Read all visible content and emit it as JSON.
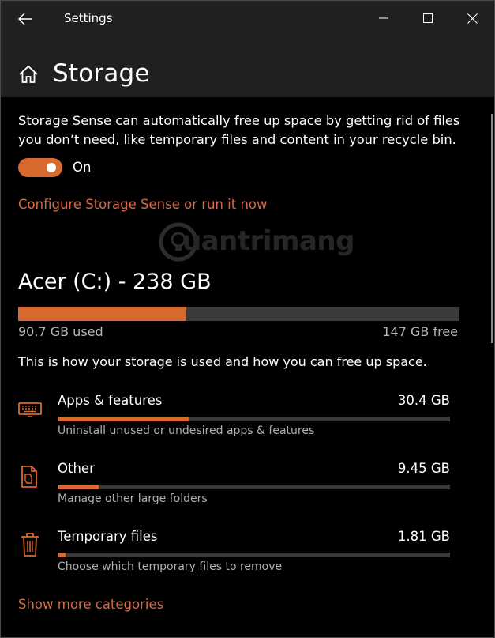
{
  "window": {
    "title": "Settings",
    "icons": {
      "back": "back-arrow-icon",
      "minimize": "minimize-icon",
      "maximize": "maximize-icon",
      "close": "close-icon"
    }
  },
  "page": {
    "title": "Storage",
    "icon": "home-icon"
  },
  "storage_sense": {
    "description": "Storage Sense can automatically free up space by getting rid of files you don’t need, like temporary files and content in your recycle bin.",
    "toggle_state": "On",
    "toggle_on": true,
    "configure_link": "Configure Storage Sense or run it now"
  },
  "watermark": {
    "text": "uantrimang"
  },
  "drive": {
    "title": "Acer (C:) - 238 GB",
    "used_label": "90.7 GB used",
    "free_label": "147 GB free",
    "used_fraction": 0.381
  },
  "usage_intro": "This is how your storage is used and how you can free up space.",
  "categories": [
    {
      "name": "Apps & features",
      "size": "30.4 GB",
      "subtitle": "Uninstall unused or undesired apps & features",
      "fraction": 0.335,
      "icon": "keyboard-icon"
    },
    {
      "name": "Other",
      "size": "9.45 GB",
      "subtitle": "Manage other large folders",
      "fraction": 0.104,
      "icon": "folder-icon"
    },
    {
      "name": "Temporary files",
      "size": "1.81 GB",
      "subtitle": "Choose which temporary files to remove",
      "fraction": 0.02,
      "icon": "trash-icon"
    }
  ],
  "show_more_link": "Show more categories",
  "colors": {
    "accent": "#d86a2f",
    "link": "#d66a45",
    "background": "#000000",
    "header": "#202020",
    "track": "#3a3a3a"
  }
}
